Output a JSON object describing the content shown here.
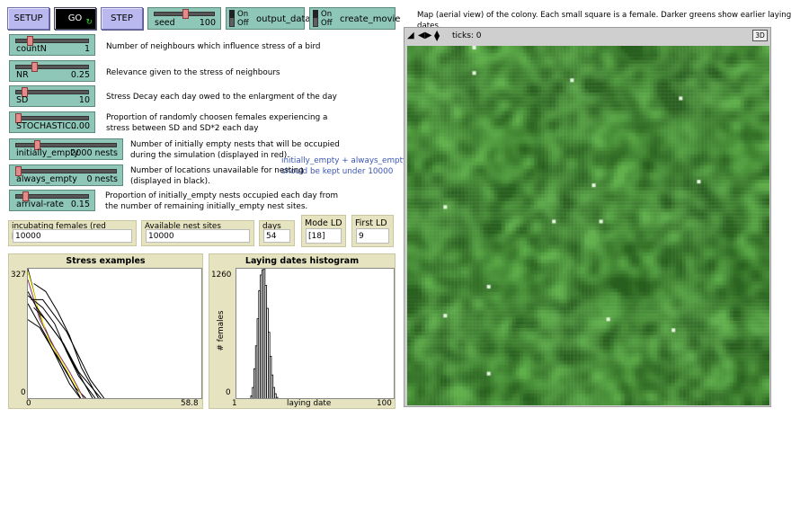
{
  "buttons": {
    "setup": "SETUP",
    "go": "GO",
    "go_icon": "forever-arrows-icon",
    "step": "STEP"
  },
  "seed_slider": {
    "label": "seed",
    "value": "100",
    "level": 0.5
  },
  "switches": [
    {
      "on": "On",
      "off": "Off",
      "label": "output_data",
      "state": "off"
    },
    {
      "on": "On",
      "off": "Off",
      "label": "create_movie",
      "state": "off"
    }
  ],
  "sliders": [
    {
      "label": "countN",
      "value": "1",
      "level": 0.18,
      "note": [
        "Number of neighbours which influence stress of a bird"
      ]
    },
    {
      "label": "NR",
      "value": "0.25",
      "level": 0.25,
      "note": [
        "Relevance given to the stress of neighbours"
      ]
    },
    {
      "label": "SD",
      "value": "10",
      "level": 0.1,
      "note": [
        "Stress Decay each day owed to the enlargment of the day"
      ]
    },
    {
      "label": "STOCHASTIC...",
      "value": "0.00",
      "level": 0.0,
      "note": [
        "Proportion of randomly choosen females experiencing a",
        "stress between SD and SD*2 each day"
      ]
    },
    {
      "label": "initially_empty",
      "value": "2000 nests",
      "level": 0.2,
      "note": [
        "Number of initially empty nests that will be occupied",
        "during the simulation (displayed in red)."
      ]
    },
    {
      "label": "always_empty",
      "value": "0 nests",
      "level": 0.0,
      "note": [
        "Number of locations unavailable for nesting",
        "(displayed in black)."
      ]
    },
    {
      "label": "arrival-rate",
      "value": "0.15",
      "level": 0.15,
      "note": [
        "Proportion of initially_empty nests occupied each day from",
        "the number of remaining initially_empty nest sites."
      ]
    }
  ],
  "side_note": [
    "initially_empty + always_empty",
    "should be kept under 10000"
  ],
  "monitors": [
    {
      "label": "incubating females (red patches)",
      "value": "10000"
    },
    {
      "label": "Available nest sites",
      "value": "10000"
    },
    {
      "label": "days",
      "value": "54"
    },
    {
      "label": "Mode LD",
      "value": "[18]"
    },
    {
      "label": "First LD",
      "value": "9"
    }
  ],
  "view": {
    "caption": "Map (aerial view) of the colony. Each small square is a female. Darker greens show earlier laying dates.",
    "ticks_label": "ticks: 0",
    "three_d": "3D",
    "icons": [
      "diagonal-toggle-icon",
      "left-right-arrows-icon",
      "up-down-arrows-icon"
    ]
  },
  "colors": {
    "button": "#b9b9ef",
    "widget": "#8ec7b7",
    "monitor": "#e6e3c0",
    "note_blue": "#3a56b4",
    "green_dark": "#2e6b24",
    "green_mid": "#3d8a2f",
    "green_light": "#5aa64a"
  },
  "chart_data": [
    {
      "type": "line",
      "title": "Stress examples",
      "xlabel": "",
      "ylabel": "",
      "xlim": [
        0,
        58.8
      ],
      "ylim": [
        0,
        327
      ],
      "x_tick_labels": [
        "0",
        "58.8"
      ],
      "y_tick_labels": [
        "0",
        "327"
      ],
      "series": [
        {
          "color": "#000000",
          "x": [
            0,
            4,
            8,
            12,
            16,
            20
          ],
          "y": [
            327,
            210,
            140,
            80,
            30,
            0
          ]
        },
        {
          "color": "#ffff00",
          "x": [
            0,
            3,
            7,
            11,
            15,
            19
          ],
          "y": [
            320,
            240,
            150,
            100,
            50,
            0
          ]
        },
        {
          "color": "#000000",
          "x": [
            0,
            5,
            9,
            13,
            17,
            23
          ],
          "y": [
            260,
            230,
            190,
            120,
            60,
            0
          ]
        },
        {
          "color": "#8b2f6b",
          "x": [
            0,
            4,
            9,
            14,
            19
          ],
          "y": [
            300,
            200,
            130,
            70,
            0
          ]
        },
        {
          "color": "#000000",
          "x": [
            2,
            6,
            10,
            14,
            18,
            24
          ],
          "y": [
            290,
            270,
            220,
            160,
            80,
            0
          ]
        },
        {
          "color": "#000000",
          "x": [
            0,
            3,
            6,
            10,
            14,
            18
          ],
          "y": [
            240,
            200,
            160,
            100,
            40,
            0
          ]
        },
        {
          "color": "#000000",
          "x": [
            1,
            5,
            9,
            13,
            17,
            21,
            26
          ],
          "y": [
            250,
            250,
            210,
            170,
            110,
            50,
            0
          ]
        },
        {
          "color": "#000000",
          "x": [
            0,
            4,
            8,
            13,
            18
          ],
          "y": [
            200,
            180,
            130,
            70,
            0
          ]
        },
        {
          "color": "#000000",
          "x": [
            2,
            6,
            11,
            16,
            22
          ],
          "y": [
            230,
            200,
            150,
            80,
            0
          ]
        },
        {
          "color": "#000000",
          "x": [
            0,
            3,
            7,
            12,
            17,
            25
          ],
          "y": [
            270,
            230,
            190,
            140,
            70,
            0
          ]
        },
        {
          "color": "#000000",
          "x": [
            20,
            40,
            58.8
          ],
          "y": [
            0,
            0,
            0
          ]
        }
      ]
    },
    {
      "type": "bar",
      "title": "Laying dates histogram",
      "xlabel": "laying date",
      "ylabel": "# females",
      "xlim": [
        1,
        100
      ],
      "ylim": [
        0,
        1260
      ],
      "x_tick_labels": [
        "1",
        "100"
      ],
      "y_tick_labels": [
        "0",
        "1260"
      ],
      "x": [
        9,
        10,
        11,
        12,
        13,
        14,
        15,
        16,
        17,
        18,
        19,
        20,
        21,
        22,
        23,
        24,
        25,
        26,
        27,
        28,
        29
      ],
      "values": [
        10,
        40,
        120,
        300,
        520,
        780,
        1050,
        1200,
        1250,
        1260,
        1100,
        880,
        650,
        420,
        240,
        120,
        60,
        25,
        10,
        5,
        2
      ]
    }
  ]
}
